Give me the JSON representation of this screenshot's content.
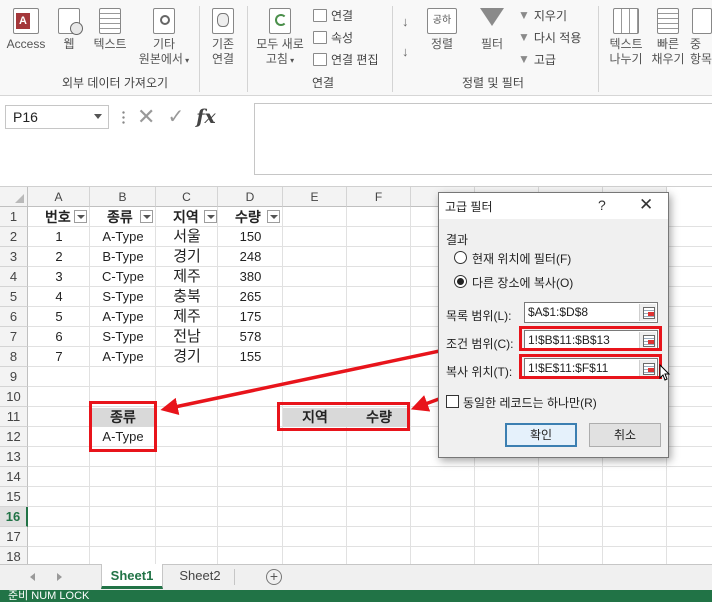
{
  "ribbon": {
    "ext_data": {
      "access": "Access",
      "web": "웹",
      "text": "텍스트",
      "other_line1": "기타",
      "other_line2": "원본에서",
      "group_label": "외부 데이터 가져오기"
    },
    "existing_line1": "기존",
    "existing_line2": "연결",
    "connections": {
      "refresh_line1": "모두 새로",
      "refresh_line2": "고침",
      "connections": "연결",
      "properties": "속성",
      "edit_links": "연결 편집",
      "group_label": "연결"
    },
    "sortfilter": {
      "sort": "정렬",
      "filter": "필터",
      "clear": "지우기",
      "reapply": "다시 적용",
      "advanced": "고급",
      "group_label": "정렬 및 필터",
      "sort_icon_text": "공하"
    },
    "datatools": {
      "text_to_cols_line1": "텍스트",
      "text_to_cols_line2": "나누기",
      "flash_fill_line1": "빠른",
      "flash_fill_line2": "채우기",
      "remove_dup_line1": "중",
      "remove_dup_line2": "항목"
    }
  },
  "formula_bar": {
    "name_box": "P16",
    "cancel_symbol": "✕",
    "enter_symbol": "✓",
    "fx_symbol": "fx",
    "content": ""
  },
  "grid": {
    "columns": [
      "A",
      "B",
      "C",
      "D",
      "E",
      "F",
      "",
      "",
      "",
      "K"
    ],
    "rows": [
      "1",
      "2",
      "3",
      "4",
      "5",
      "6",
      "7",
      "8",
      "9",
      "10",
      "11",
      "12",
      "13",
      "14",
      "15",
      "16",
      "17",
      "18"
    ],
    "selected_row": "16",
    "headers": [
      "번호",
      "종류",
      "지역",
      "수량"
    ],
    "data": [
      [
        "1",
        "A-Type",
        "서울",
        "150"
      ],
      [
        "2",
        "B-Type",
        "경기",
        "248"
      ],
      [
        "3",
        "C-Type",
        "제주",
        "380"
      ],
      [
        "4",
        "S-Type",
        "충북",
        "265"
      ],
      [
        "5",
        "A-Type",
        "제주",
        "175"
      ],
      [
        "6",
        "S-Type",
        "전남",
        "578"
      ],
      [
        "7",
        "A-Type",
        "경기",
        "155"
      ]
    ],
    "criteria_header": "종류",
    "criteria_value": "A-Type",
    "copy_headers": [
      "지역",
      "수량"
    ]
  },
  "sheets": {
    "tabs": [
      "Sheet1",
      "Sheet2"
    ],
    "active": "Sheet1",
    "add_symbol": "+"
  },
  "dialog": {
    "title": "고급 필터",
    "help": "?",
    "close": "✕",
    "action_label": "결과",
    "option_inplace": "현재 위치에 필터(F)",
    "option_copy": "다른 장소에 복사(O)",
    "selected_option": "copy",
    "list_range_label": "목록 범위(L):",
    "list_range_value": "$A$1:$D$8",
    "criteria_range_label": "조건 범위(C):",
    "criteria_range_value": "1!$B$11:$B$13",
    "copy_to_label": "복사 위치(T):",
    "copy_to_value": "1!$E$11:$F$11",
    "unique_label": "동일한 레코드는 하나만(R)",
    "unique_checked": false,
    "ok": "확인",
    "cancel": "취소"
  },
  "status": {
    "text": "준비    NUM LOCK"
  },
  "colors": {
    "excel_green": "#217346",
    "highlight_red": "#e8141b"
  }
}
